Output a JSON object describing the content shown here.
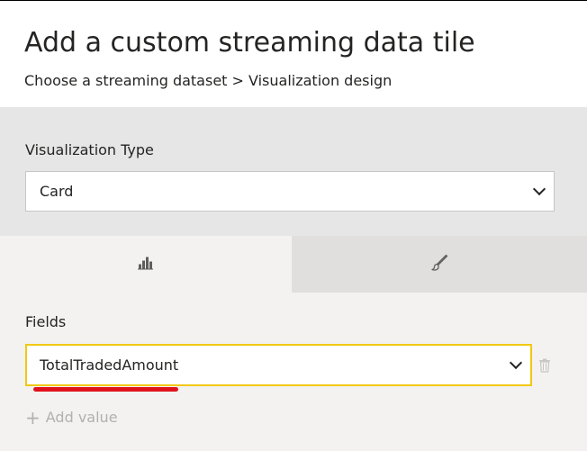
{
  "dialog": {
    "title": "Add a custom streaming data tile",
    "breadcrumb": "Choose a streaming dataset > Visualization design"
  },
  "visualization": {
    "label": "Visualization Type",
    "selected": "Card"
  },
  "tabs": [
    {
      "id": "fields",
      "icon": "bar-chart-icon",
      "active": true
    },
    {
      "id": "format",
      "icon": "paintbrush-icon",
      "active": false
    }
  ],
  "fields": {
    "label": "Fields",
    "selected": "TotalTradedAmount",
    "add_label": "Add value"
  },
  "colors": {
    "accent_border": "#f2c811",
    "annotation": "#e0121c",
    "gray_panel": "#e6e6e6"
  }
}
